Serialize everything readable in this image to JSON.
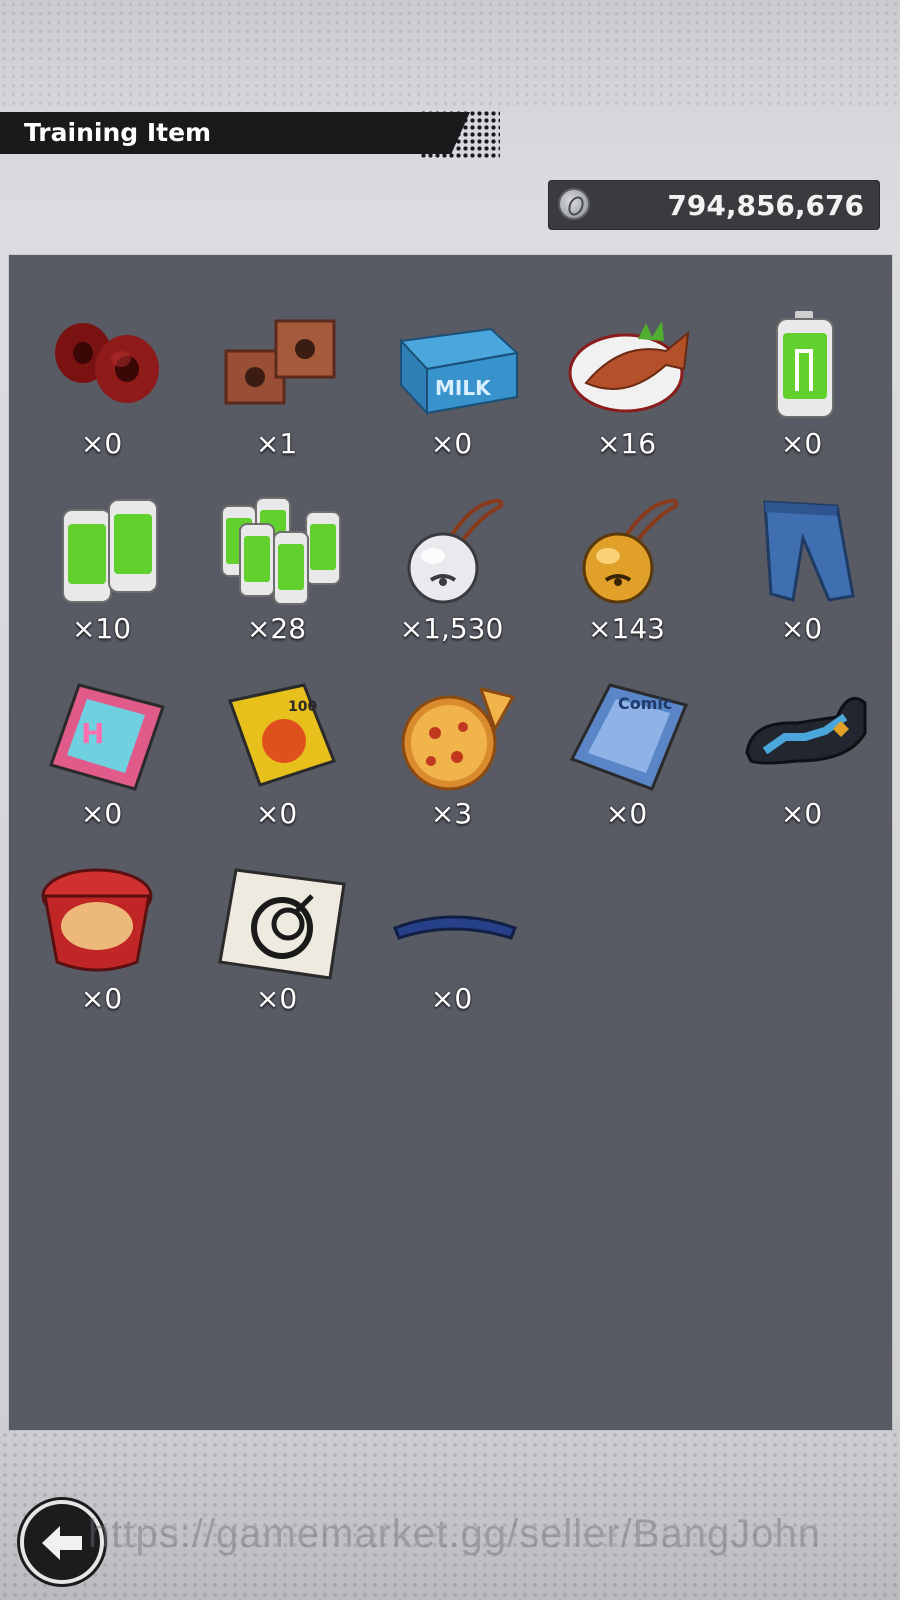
{
  "header": {
    "title": "Training Item"
  },
  "currency": {
    "icon": "zeni-coin-icon",
    "value": "794,856,676"
  },
  "items": [
    {
      "icon": "red-weights-icon",
      "count": "×0"
    },
    {
      "icon": "copper-weights-icon",
      "count": "×1"
    },
    {
      "icon": "milk-crate-icon",
      "count": "×0"
    },
    {
      "icon": "grilled-fish-icon",
      "count": "×16"
    },
    {
      "icon": "battery-icon",
      "count": "×0"
    },
    {
      "icon": "double-battery-icon",
      "count": "×10"
    },
    {
      "icon": "battery-pack-icon",
      "count": "×28"
    },
    {
      "icon": "silver-bell-icon",
      "count": "×1,530"
    },
    {
      "icon": "gold-bell-icon",
      "count": "×143"
    },
    {
      "icon": "jeans-icon",
      "count": "×0"
    },
    {
      "icon": "magazine-pink-icon",
      "count": "×0"
    },
    {
      "icon": "book-yellow-icon",
      "count": "×0"
    },
    {
      "icon": "pizza-icon",
      "count": "×3"
    },
    {
      "icon": "comic-book-icon",
      "count": "×0"
    },
    {
      "icon": "armband-icon",
      "count": "×0"
    },
    {
      "icon": "cup-noodle-icon",
      "count": "×0"
    },
    {
      "icon": "capsule-card-icon",
      "count": "×0"
    },
    {
      "icon": "headband-icon",
      "count": "×0"
    }
  ],
  "back_button": {
    "icon": "back-arrow-icon"
  },
  "watermark": "https://gamemarket.gg/seller/BangJohn"
}
